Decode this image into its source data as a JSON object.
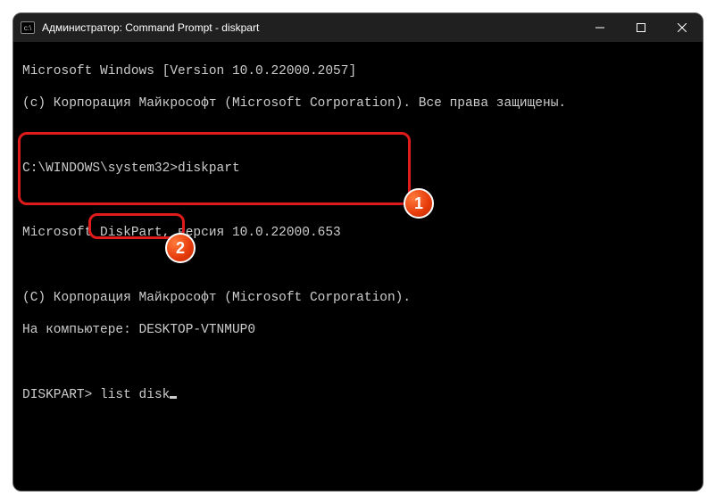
{
  "window": {
    "title": "Администратор: Command Prompt - diskpart"
  },
  "terminal": {
    "line1": "Microsoft Windows [Version 10.0.22000.2057]",
    "line2": "(c) Корпорация Майкрософт (Microsoft Corporation). Все права защищены.",
    "blank1": " ",
    "prompt1_path": "C:\\WINDOWS\\system32>",
    "prompt1_cmd": "diskpart",
    "blank2": " ",
    "dp_line1": "Microsoft DiskPart, версия 10.0.22000.653",
    "blank3": " ",
    "dp_line2": "(C) Корпорация Майкрософт (Microsoft Corporation).",
    "dp_line3": "На компьютере: DESKTOP-VTNMUP0",
    "blank4": " ",
    "prompt2": "DISKPART>",
    "prompt2_cmd": " list disk"
  },
  "annotations": {
    "badge1": "1",
    "badge2": "2"
  }
}
